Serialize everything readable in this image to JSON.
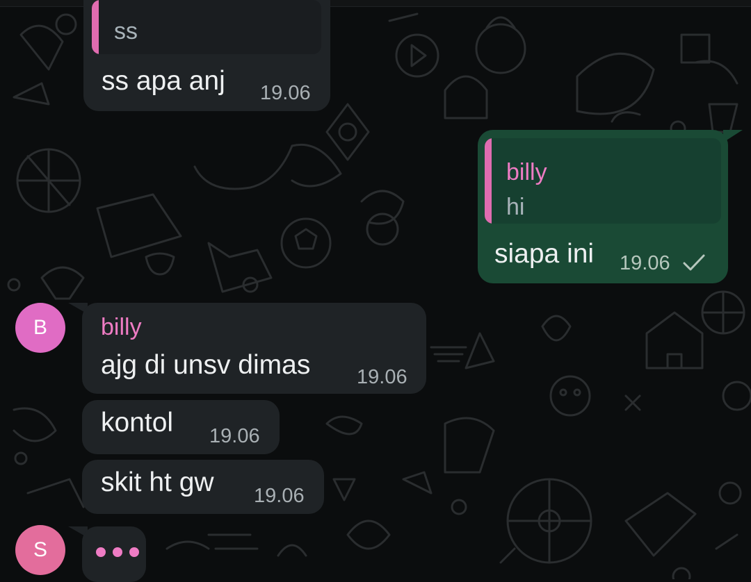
{
  "colors": {
    "background": "#0b0d0e",
    "incoming_bubble": "#1f2326",
    "outgoing_bubble": "#1a4a35",
    "accent_pink": "#ef7cc4",
    "avatar_b": "#e06cc4",
    "avatar_s": "#e36d9c"
  },
  "messages": {
    "m1": {
      "quote_text": "ss",
      "text": "ss apa anj",
      "time": "19.06"
    },
    "m2": {
      "quote_name": "billy",
      "quote_text": "hi",
      "text": "siapa ini",
      "time": "19.06",
      "status_icon": "check-icon"
    },
    "m3": {
      "sender": "billy",
      "text": "ajg di unsv dimas",
      "time": "19.06"
    },
    "m4": {
      "text": "kontol",
      "time": "19.06"
    },
    "m5": {
      "text": "skit ht gw",
      "time": "19.06"
    }
  },
  "avatars": {
    "b": "B",
    "s": "S"
  },
  "typing_indicator": "typing-dots-icon"
}
